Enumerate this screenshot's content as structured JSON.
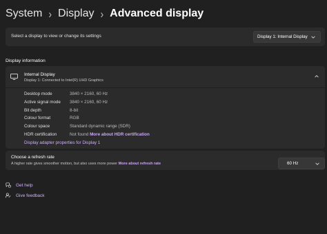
{
  "breadcrumb": {
    "items": [
      "System",
      "Display"
    ],
    "current": "Advanced display",
    "separator": "›"
  },
  "display_select": {
    "label": "Select a display to view or change its settings",
    "value": "Display 1: Internal Display"
  },
  "section_title": "Display information",
  "display_info": {
    "name": "Internal Display",
    "subtitle": "Display 1: Connected to Intel(R) UHD Graphics",
    "properties": [
      {
        "label": "Desktop mode",
        "value": "3840 × 2160, 60 Hz"
      },
      {
        "label": "Active signal mode",
        "value": "3840 × 2160, 60 Hz"
      },
      {
        "label": "Bit depth",
        "value": "8-bit"
      },
      {
        "label": "Colour format",
        "value": "RGB"
      },
      {
        "label": "Colour space",
        "value": "Standard dynamic range (SDR)"
      }
    ],
    "hdr": {
      "label": "HDR certification",
      "value": "Not found",
      "link": "More about HDR certification"
    },
    "adapter_link": "Display adapter properties for Display 1"
  },
  "refresh_rate": {
    "title": "Choose a refresh rate",
    "subtitle": "A higher rate gives smoother motion, but also uses more power",
    "link": "More about refresh rate",
    "value": "60 Hz"
  },
  "footer_links": {
    "help": "Get help",
    "feedback": "Give feedback"
  },
  "colors": {
    "background": "#202020",
    "card": "#2b2b2b",
    "accent_link": "#c9a8f0"
  },
  "icons": [
    "chevron-down-icon",
    "chevron-up-icon",
    "monitor-icon",
    "help-icon",
    "feedback-icon"
  ]
}
